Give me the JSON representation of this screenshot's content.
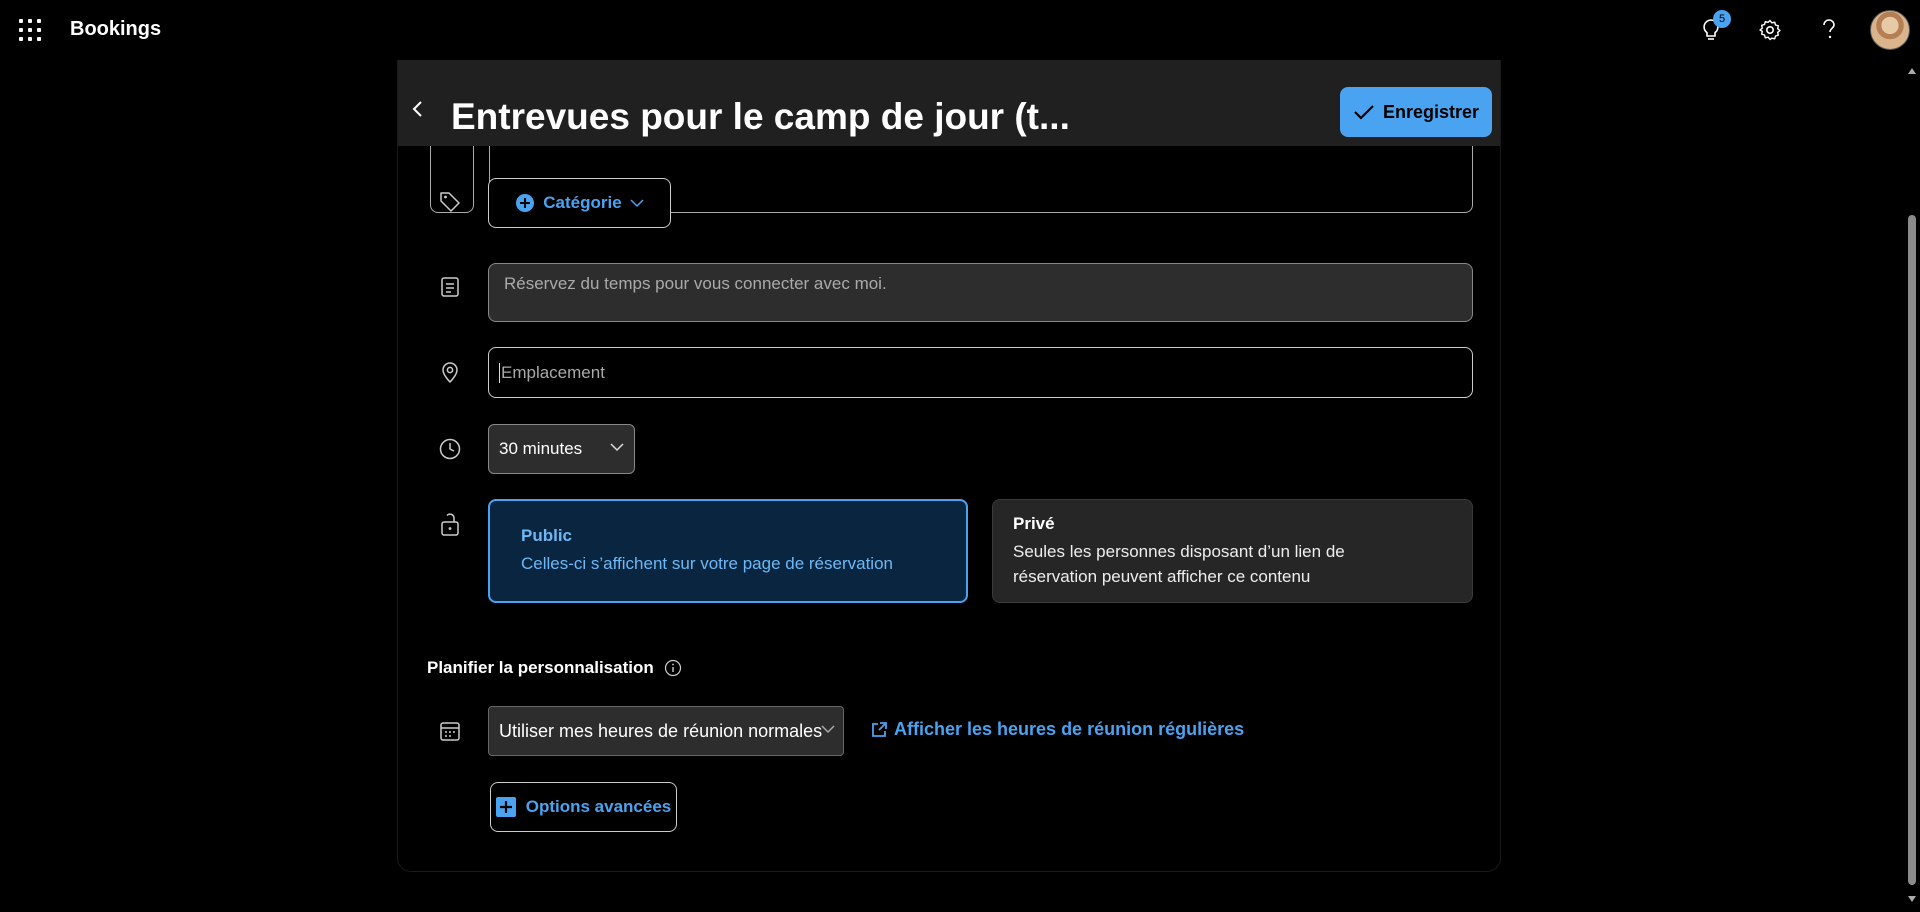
{
  "topbar": {
    "app_name": "Bookings",
    "notification_count": "5",
    "icons": [
      "apps-icon",
      "lightbulb-icon",
      "gear-icon",
      "help-icon",
      "avatar"
    ]
  },
  "panel": {
    "title": "Entrevues pour le camp de jour (t...",
    "save_label": "Enregistrer"
  },
  "form": {
    "category_label": "Catégorie",
    "description_placeholder": "Réservez du temps pour vous connecter avec moi.",
    "location_placeholder": "Emplacement",
    "duration_value": "30 minutes",
    "visibility": {
      "public_title": "Public",
      "public_desc": "Celles-ci s’affichent sur votre page de réservation",
      "private_title": "Privé",
      "private_desc_line1": "Seules les personnes disposant d’un lien de",
      "private_desc_line2": "réservation peuvent afficher ce contenu"
    }
  },
  "schedule": {
    "section_title": "Planifier la personnalisation",
    "hours_value": "Utiliser mes heures de réunion normales",
    "hours_link": "Afficher les heures de réunion régulières",
    "advanced_label": "Options avancées"
  },
  "colors": {
    "accent": "#4aa3f0",
    "background": "#000000",
    "header": "#202020",
    "public_card": "#0a2540"
  }
}
